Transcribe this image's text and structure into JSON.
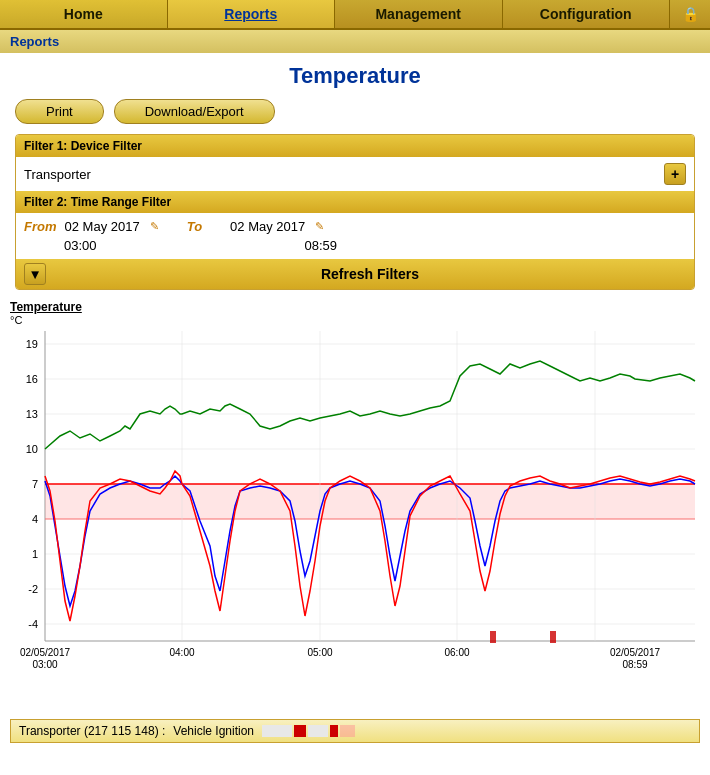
{
  "nav": {
    "items": [
      {
        "label": "Home",
        "active": false
      },
      {
        "label": "Reports",
        "active": true
      },
      {
        "label": "Management",
        "active": false
      },
      {
        "label": "Configuration",
        "active": false
      }
    ],
    "lock_icon": "🔒"
  },
  "breadcrumb": "Reports",
  "page_title": "Temperature",
  "toolbar": {
    "print_label": "Print",
    "download_label": "Download/Export"
  },
  "filter1": {
    "header": "Filter 1: Device Filter",
    "value": "Transporter",
    "add_label": "+"
  },
  "filter2": {
    "header": "Filter 2: Time Range Filter",
    "from_label": "From",
    "from_date": "02 May 2017",
    "from_time": "03:00",
    "to_label": "To",
    "to_date": "02 May 2017",
    "to_time": "08:59"
  },
  "refresh": {
    "label": "Refresh Filters",
    "collapse_icon": "▼"
  },
  "chart": {
    "title": "Temperature",
    "unit": "°C",
    "x_labels": [
      "02/05/2017\n03:00",
      "04:00",
      "05:00",
      "06:00",
      "02/05/2017\n08:59"
    ],
    "y_labels": [
      "19",
      "16",
      "13",
      "10",
      "7",
      "4",
      "1",
      "-2",
      "-4"
    ]
  },
  "legend": {
    "device": "Transporter (217 115 148) :",
    "event": "Vehicle Ignition"
  }
}
